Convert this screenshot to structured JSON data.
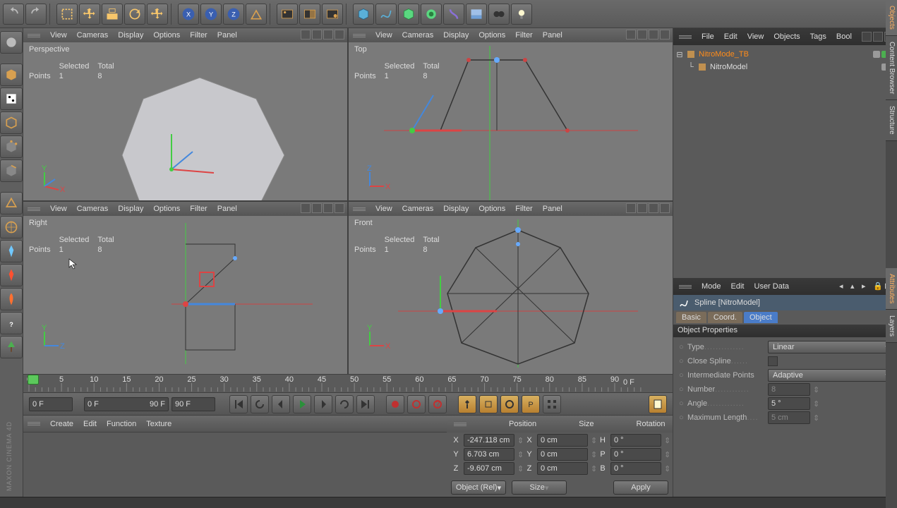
{
  "top_toolbar_icons": [
    "undo",
    "redo",
    "sep",
    "live-select",
    "move",
    "scale",
    "rotate",
    "place",
    "sep",
    "x-axis",
    "y-axis",
    "z-axis",
    "coord-system",
    "sep",
    "render-view",
    "render-region",
    "render-settings",
    "sep",
    "cube-prim",
    "spline-prim",
    "nurbs-prim",
    "generator-prim",
    "deformer-prim",
    "env-prim",
    "camera-prim",
    "light-prim"
  ],
  "left_toolbar_icons": [
    "model-mode",
    "object-mode",
    "texture-mode",
    "workplane-mode",
    "point-mode",
    "edge-mode",
    "polygon-mode",
    "axis-mode",
    "tweak-mode",
    "uv-point",
    "uv-poly",
    "sculpt",
    "help",
    "tree"
  ],
  "viewport_menu": [
    "View",
    "Cameras",
    "Display",
    "Options",
    "Filter",
    "Panel"
  ],
  "viewports": [
    {
      "label": "Perspective",
      "stats": {
        "selected": 1,
        "total": 8
      }
    },
    {
      "label": "Top",
      "stats": {
        "selected": 1,
        "total": 8
      }
    },
    {
      "label": "Right",
      "stats": {
        "selected": 1,
        "total": 8
      }
    },
    {
      "label": "Front",
      "stats": {
        "selected": 1,
        "total": 8
      }
    }
  ],
  "stats_header": {
    "col1": "Selected",
    "col2": "Total",
    "row": "Points"
  },
  "timeline": {
    "start": 0,
    "end": 90,
    "ticks": [
      0,
      5,
      10,
      15,
      20,
      25,
      30,
      35,
      40,
      45,
      50,
      55,
      60,
      65,
      70,
      75,
      80,
      85,
      90
    ]
  },
  "time": {
    "cur_frame": "0 F",
    "field_min": "0 F",
    "field_max": "90 F",
    "range_max": "90 F",
    "display": "0 F"
  },
  "material_menu": [
    "Create",
    "Edit",
    "Function",
    "Texture"
  ],
  "coord": {
    "headers": [
      "Position",
      "Size",
      "Rotation"
    ],
    "rows": [
      {
        "a": "X",
        "pv": "-247.118 cm",
        "s": "X",
        "sv": "0 cm",
        "r": "H",
        "rv": "0 °"
      },
      {
        "a": "Y",
        "pv": "6.703 cm",
        "s": "Y",
        "sv": "0 cm",
        "r": "P",
        "rv": "0 °"
      },
      {
        "a": "Z",
        "pv": "-9.607 cm",
        "s": "Z",
        "sv": "0 cm",
        "r": "B",
        "rv": "0 °"
      }
    ],
    "mode": "Object (Rel)",
    "size_mode": "Size",
    "apply": "Apply"
  },
  "right_menu": [
    "File",
    "Edit",
    "View",
    "Objects",
    "Tags",
    "Bool"
  ],
  "obj_tree": [
    {
      "name": "NitroMode_TB",
      "indent": 0,
      "selected": true,
      "icon": "generator",
      "dots": [
        "#9a9a9a",
        "#4caf50",
        "#ff9800"
      ]
    },
    {
      "name": "NitroModel",
      "indent": 1,
      "selected": false,
      "icon": "spline",
      "dots": [
        "#9a9a9a",
        "#4caf50"
      ]
    }
  ],
  "attr_menu": [
    "Mode",
    "Edit",
    "User Data"
  ],
  "attr_head": "Spline [NitroModel]",
  "attr_tabs": [
    "Basic",
    "Coord.",
    "Object"
  ],
  "attr_active_tab": 2,
  "attr_section": "Object Properties",
  "attr_props": [
    {
      "label": "Type",
      "type": "select",
      "value": "Linear"
    },
    {
      "label": "Close Spline",
      "type": "check",
      "value": false
    },
    {
      "label": "Intermediate Points",
      "type": "select",
      "value": "Adaptive"
    },
    {
      "label": "Number",
      "type": "num",
      "value": "8",
      "disabled": true
    },
    {
      "label": "Angle",
      "type": "num",
      "value": "5 °"
    },
    {
      "label": "Maximum Length",
      "type": "num",
      "value": "5 cm",
      "disabled": true
    }
  ],
  "vtabs": [
    "Objects",
    "Content Browser",
    "Structure",
    "Attributes",
    "Layers"
  ],
  "brand": "MAXON CINEMA 4D"
}
